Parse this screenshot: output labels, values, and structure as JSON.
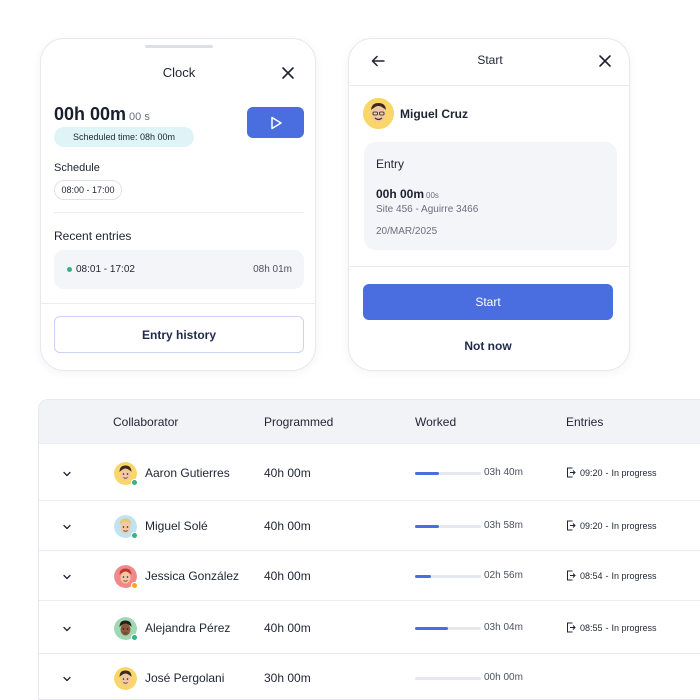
{
  "clock_card": {
    "title": "Clock",
    "timer_main": "00h 00m",
    "timer_sec": "00 s",
    "scheduled_badge": "Scheduled time: 08h 00m",
    "schedule_label": "Schedule",
    "schedule_range": "08:00 - 17:00",
    "recent_label": "Recent entries",
    "recent_entry": {
      "time": "08:01 - 17:02",
      "duration": "08h 01m"
    },
    "history_button": "Entry history"
  },
  "start_card": {
    "title": "Start",
    "user_name": "Miguel Cruz",
    "entry_heading": "Entry",
    "entry_time_main": "00h 00m",
    "entry_time_sec": "00s",
    "entry_site": "Site 456 - Aguirre 3466",
    "entry_date": "20/MAR/2025",
    "start_button": "Start",
    "not_now_button": "Not now"
  },
  "table": {
    "headers": [
      "Collaborator",
      "Programmed",
      "Worked",
      "Entries"
    ],
    "rows": [
      {
        "name": "Aaron Gutierres",
        "programmed": "40h 00m",
        "worked": "03h 40m",
        "progress": 0.36,
        "entry_time": "09:20",
        "entry_status": "In progress",
        "avatar": "yellow-male-avatar",
        "status_color": "#36b37e"
      },
      {
        "name": "Miguel Solé",
        "programmed": "40h 00m",
        "worked": "03h 58m",
        "progress": 0.36,
        "entry_time": "09:20",
        "entry_status": "In progress",
        "avatar": "blue-blond-avatar",
        "status_color": "#36b37e"
      },
      {
        "name": "Jessica González",
        "programmed": "40h 00m",
        "worked": "02h 56m",
        "progress": 0.24,
        "entry_time": "08:54",
        "entry_status": "In progress",
        "avatar": "red-female-avatar",
        "status_color": "#f5a623"
      },
      {
        "name": "Alejandra Pérez",
        "programmed": "40h 00m",
        "worked": "03h 04m",
        "progress": 0.5,
        "entry_time": "08:55",
        "entry_status": "In progress",
        "avatar": "green-female-avatar",
        "status_color": "#36b37e"
      },
      {
        "name": "José Pergolani",
        "programmed": "30h 00m",
        "worked": "00h 00m",
        "progress": 0,
        "entry_time": "",
        "entry_status": "",
        "avatar": "yellow-male-avatar",
        "status_color": ""
      }
    ]
  },
  "colors": {
    "accent": "#4a6ee0",
    "online": "#36b37e",
    "away": "#f5a623",
    "badge_bg": "#dff4f6"
  }
}
